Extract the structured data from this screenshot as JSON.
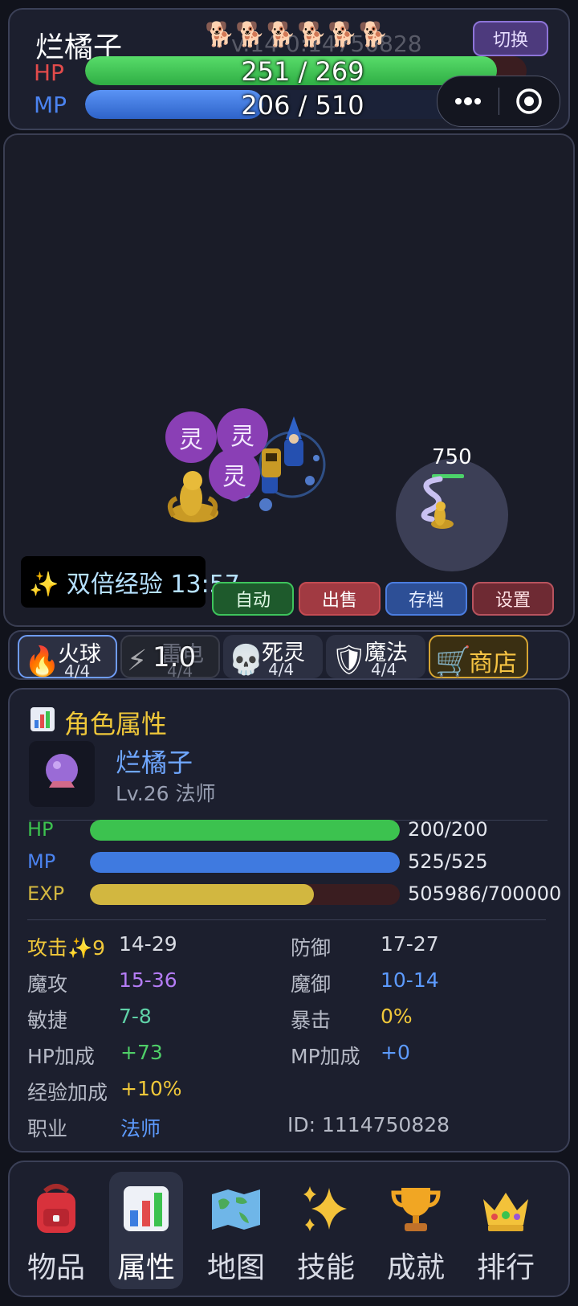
{
  "header": {
    "player_name": "烂橘子",
    "pets": "🐕🐕🐕🐕🐕🐕",
    "pets_overlay_text": "v.14   0:14750828",
    "switch_label": "切换",
    "hp_label": "HP",
    "hp_text": "251 / 269",
    "hp_current": 251,
    "hp_max": 269,
    "mp_label": "MP",
    "mp_text": "206 / 510",
    "mp_current": 206,
    "mp_max": 510,
    "more_icon": "ellipsis-icon",
    "close_icon": "target-icon"
  },
  "game": {
    "ghosts": [
      "灵",
      "灵",
      "灵"
    ],
    "boss_hp_text": "750",
    "exp_banner": "✨ 双倍经验 13:57",
    "buttons": {
      "auto": "自动",
      "sell": "出售",
      "save": "存档",
      "settings": "设置"
    }
  },
  "skills": [
    {
      "icon": "🔥",
      "name": "火球",
      "count": "4/4"
    },
    {
      "icon": "⚡",
      "name": "雷电",
      "count": "4/4",
      "cooldown": "1.0"
    },
    {
      "icon": "💀",
      "name": "死灵",
      "count": "4/4"
    },
    {
      "icon": "🛡",
      "name": "魔法",
      "count": "4/4"
    },
    {
      "icon": "🛒",
      "name": "商店"
    }
  ],
  "stats": {
    "title": "角色属性",
    "name": "烂橘子",
    "level": "Lv.26 法师",
    "hp_label": "HP",
    "hp_text": "200/200",
    "hp_fraction": 1.0,
    "mp_label": "MP",
    "mp_text": "525/525",
    "mp_fraction": 1.0,
    "exp_label": "EXP",
    "exp_text": "505986/700000",
    "exp_fraction": 0.7228,
    "attack_label": "攻击✨9",
    "attack_value": "14-29",
    "defense_label": "防御",
    "defense_value": "17-27",
    "mattack_label": "魔攻",
    "mattack_value": "15-36",
    "mdefense_label": "魔御",
    "mdefense_value": "10-14",
    "agility_label": "敏捷",
    "agility_value": "7-8",
    "crit_label": "暴击",
    "crit_value": "0%",
    "hpbonus_label": "HP加成",
    "hpbonus_value": "+73",
    "mpbonus_label": "MP加成",
    "mpbonus_value": "+0",
    "expbonus_label": "经验加成",
    "expbonus_value": "+10%",
    "class_label": "职业",
    "class_value": "法师",
    "id_text": "ID: 1114750828"
  },
  "nav": [
    {
      "label": "物品",
      "icon": "backpack-icon"
    },
    {
      "label": "属性",
      "icon": "bar-chart-icon",
      "active": true
    },
    {
      "label": "地图",
      "icon": "map-icon"
    },
    {
      "label": "技能",
      "icon": "sparkles-icon"
    },
    {
      "label": "成就",
      "icon": "trophy-icon"
    },
    {
      "label": "排行",
      "icon": "crown-icon"
    }
  ],
  "colors": {
    "hp_green": "#3cc24f",
    "mp_blue": "#3f7ae0",
    "exp_gold": "#d2b740",
    "gold_text": "#f0c83a",
    "purple_text": "#b47cf5",
    "cyan_text": "#5fd1a7",
    "blue_text": "#5d9bff"
  }
}
